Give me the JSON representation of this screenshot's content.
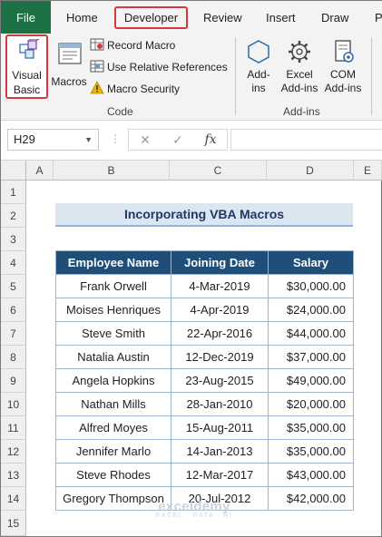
{
  "ribbon": {
    "tabs": [
      {
        "label": "File"
      },
      {
        "label": "Home"
      },
      {
        "label": "Developer"
      },
      {
        "label": "Review"
      },
      {
        "label": "Insert"
      },
      {
        "label": "Draw"
      },
      {
        "label": "P"
      }
    ],
    "active_tab": "Developer",
    "code_group": {
      "label": "Code",
      "visual_basic": {
        "line1": "Visual",
        "line2": "Basic"
      },
      "macros": "Macros",
      "record_macro": "Record Macro",
      "use_relative_references": "Use Relative References",
      "macro_security": "Macro Security"
    },
    "addins_group": {
      "label": "Add-ins",
      "addins": {
        "line1": "Add-",
        "line2": "ins"
      },
      "excel_addins": {
        "line1": "Excel",
        "line2": "Add-ins"
      },
      "com_addins": {
        "line1": "COM",
        "line2": "Add-ins"
      }
    }
  },
  "formula_bar": {
    "name_box": "H29",
    "cancel_symbol": "✕",
    "enter_symbol": "✓",
    "fx_symbol": "fx",
    "value": ""
  },
  "sheet": {
    "columns": [
      "A",
      "B",
      "C",
      "D",
      "E"
    ],
    "rows": [
      "1",
      "2",
      "3",
      "4",
      "5",
      "6",
      "7",
      "8",
      "9",
      "10",
      "11",
      "12",
      "13",
      "14",
      "15"
    ],
    "title": "Incorporating VBA Macros",
    "table": {
      "headers": [
        "Employee Name",
        "Joining Date",
        "Salary"
      ],
      "rows": [
        [
          "Frank Orwell",
          "4-Mar-2019",
          "$30,000.00"
        ],
        [
          "Moises Henriques",
          "4-Apr-2019",
          "$24,000.00"
        ],
        [
          "Steve Smith",
          "22-Apr-2016",
          "$44,000.00"
        ],
        [
          "Natalia Austin",
          "12-Dec-2019",
          "$37,000.00"
        ],
        [
          "Angela Hopkins",
          "23-Aug-2015",
          "$49,000.00"
        ],
        [
          "Nathan Mills",
          "28-Jan-2010",
          "$20,000.00"
        ],
        [
          "Alfred Moyes",
          "15-Aug-2011",
          "$35,000.00"
        ],
        [
          "Jennifer Marlo",
          "14-Jan-2013",
          "$35,000.00"
        ],
        [
          "Steve Rhodes",
          "12-Mar-2017",
          "$43,000.00"
        ],
        [
          "Gregory Thompson",
          "20-Jul-2012",
          "$42,000.00"
        ]
      ]
    }
  },
  "watermark": {
    "main": "exceldemy",
    "sub": "EXCEL · DATA · BI"
  },
  "colors": {
    "file_tab": "#1e7145",
    "highlight_border": "#d9363e",
    "table_header": "#1f4e79",
    "title_fill": "#dce6f1",
    "table_border": "#9ab6d3"
  }
}
